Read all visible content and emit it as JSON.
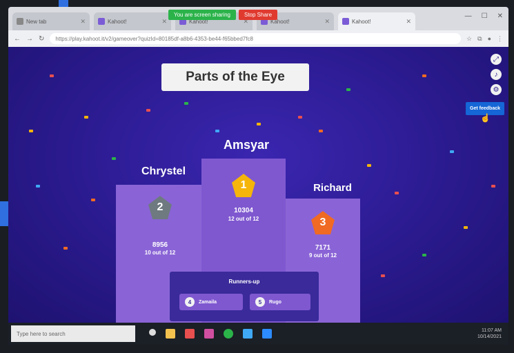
{
  "browser": {
    "tabs": [
      {
        "label": "New tab"
      },
      {
        "label": "Kahoot!"
      },
      {
        "label": "Kahoot!"
      },
      {
        "label": "Kahoot!"
      },
      {
        "label": "Kahoot!"
      }
    ],
    "share_message": "You are screen sharing",
    "stop_share_label": "Stop Share",
    "url": "https://play.kahoot.it/v2/gameover?quizId=80185df-a8b6-4353-be44-f65bbed7fc8"
  },
  "game": {
    "title": "Parts of the Eye",
    "feedback_label": "Get feedback",
    "podium": [
      {
        "rank": "2",
        "name": "Chrystel",
        "score": "8956",
        "correct": "10 out of 12"
      },
      {
        "rank": "1",
        "name": "Amsyar",
        "score": "10304",
        "correct": "12 out of 12"
      },
      {
        "rank": "3",
        "name": "Richard",
        "score": "7171",
        "correct": "9 out of 12"
      }
    ],
    "runners_up_heading": "Runners-up",
    "runners_up": [
      {
        "rank": "4",
        "name": "Zamaila"
      },
      {
        "rank": "5",
        "name": "Rugo"
      }
    ]
  },
  "taskbar": {
    "search_placeholder": "Type here to search",
    "time": "11:07 AM",
    "date": "10/14/2021"
  },
  "colors": {
    "stage": "#2a1a8e",
    "podium": "#8a64d6",
    "gold": "#f5b50a",
    "silver": "#6e7a80",
    "bronze": "#f06a23",
    "share_green": "#2bb34a",
    "stop_red": "#e03a2f"
  }
}
